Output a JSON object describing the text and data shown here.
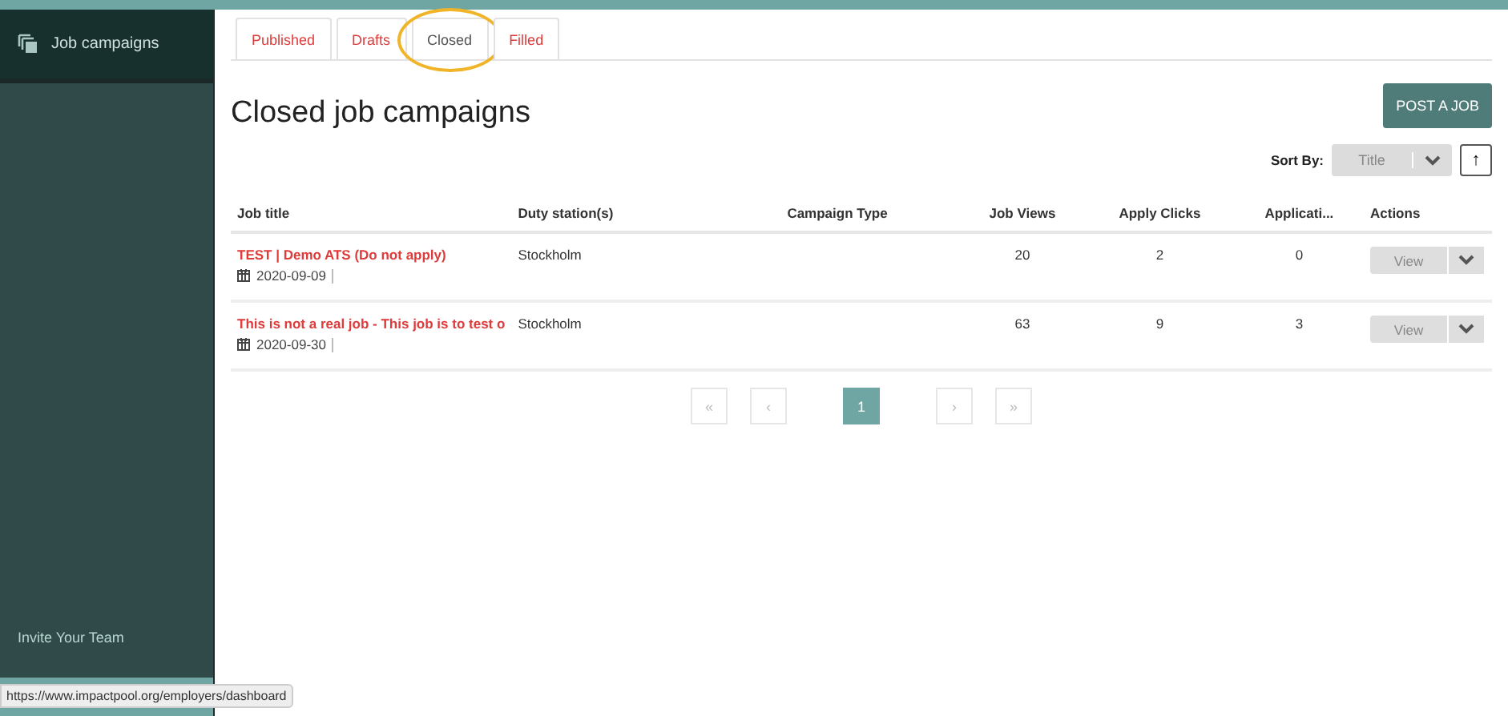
{
  "sidebar": {
    "items": [
      {
        "label": "Job campaigns",
        "selected": true
      }
    ],
    "footer_link": "Invite Your Team"
  },
  "tabs": [
    {
      "label": "Published",
      "selected": false
    },
    {
      "label": "Drafts",
      "selected": false
    },
    {
      "label": "Closed",
      "selected": true
    },
    {
      "label": "Filled",
      "selected": false
    }
  ],
  "page_title": "Closed job campaigns",
  "post_button": "POST A JOB",
  "sort": {
    "label": "Sort By:",
    "value": "Title",
    "direction_icon": "↑"
  },
  "table": {
    "columns": [
      "Job title",
      "Duty station(s)",
      "Campaign Type",
      "Job Views",
      "Apply Clicks",
      "Applicati...",
      "Actions"
    ],
    "rows": [
      {
        "title": "TEST | Demo ATS (Do not apply)",
        "date": "2020-09-09",
        "station": "Stockholm",
        "views": "20",
        "clicks": "2",
        "applications": "0",
        "action": "View"
      },
      {
        "title": "This is not a real job - This job is to test o",
        "date": "2020-09-30",
        "station": "Stockholm",
        "views": "63",
        "clicks": "9",
        "applications": "3",
        "action": "View"
      }
    ]
  },
  "pagination": [
    {
      "label": "«",
      "selected": false
    },
    {
      "label": "‹",
      "selected": false
    },
    {
      "label": "1",
      "selected": true
    },
    {
      "label": "›",
      "selected": false
    },
    {
      "label": "»",
      "selected": false
    }
  ],
  "status_url": "https://www.impactpool.org/employers/dashboard"
}
